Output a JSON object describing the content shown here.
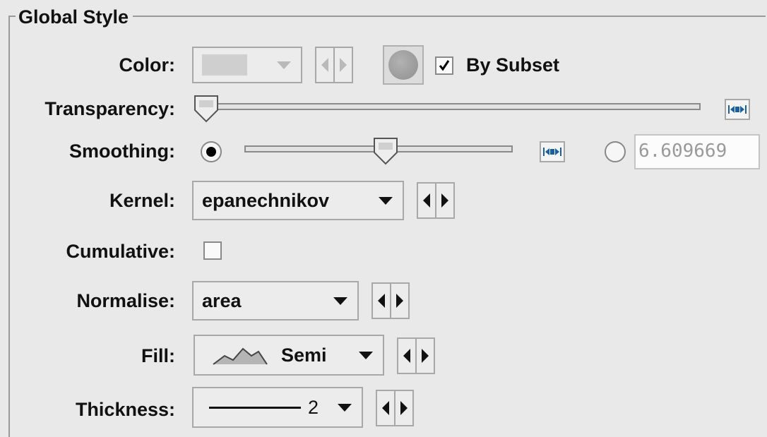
{
  "panel": {
    "title": "Global Style"
  },
  "color": {
    "label": "Color:",
    "swatch_color": "#c8c8c8",
    "by_subset_label": "By Subset",
    "by_subset_checked": true
  },
  "transparency": {
    "label": "Transparency:",
    "value_fraction": 0.0
  },
  "smoothing": {
    "label": "Smoothing:",
    "slider_fraction": 0.52,
    "value_text": "6.609669",
    "slider_selected": true
  },
  "kernel": {
    "label": "Kernel:",
    "value": "epanechnikov"
  },
  "cumulative": {
    "label": "Cumulative:",
    "checked": false
  },
  "normalise": {
    "label": "Normalise:",
    "value": "area"
  },
  "fill": {
    "label": "Fill:",
    "value": "Semi"
  },
  "thickness": {
    "label": "Thickness:",
    "value": "2"
  },
  "icons": {
    "spin": "left-right-arrows-icon",
    "fill": "semi-fill-curve-icon",
    "fit": "fit-range-icon"
  }
}
